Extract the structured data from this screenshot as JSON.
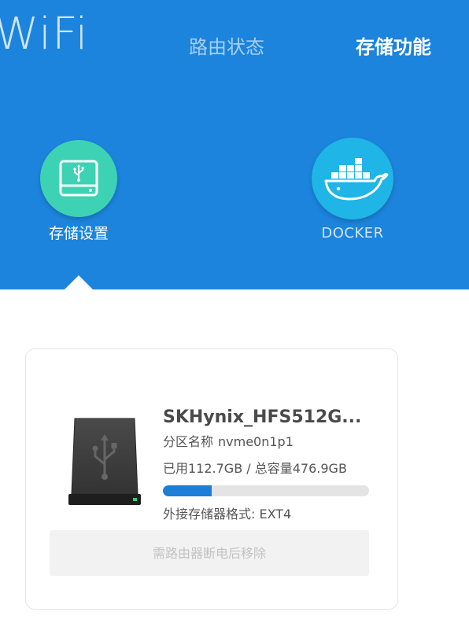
{
  "header": {
    "logo_text": "WiFi",
    "nav": [
      {
        "label": "路由状态",
        "active": false
      },
      {
        "label": "存储功能",
        "active": true
      }
    ],
    "background_color": "#1c84dc"
  },
  "features": [
    {
      "label": "存储设置",
      "icon": "usb-drive-icon",
      "color": "#3ed2b4",
      "selected": true
    },
    {
      "label": "DOCKER",
      "icon": "docker-whale-icon",
      "color": "#1fb5e6",
      "selected": false
    }
  ],
  "disk": {
    "icon": "usb-hard-drive-icon",
    "name": "SKHynix_HFS512G...",
    "partition_label": "分区名称",
    "partition_value": "nvme0n1p1",
    "usage_text": "已用112.7GB / 总容量476.9GB",
    "used_gb": 112.7,
    "total_gb": 476.9,
    "usage_fraction": 0.236,
    "format_text": "外接存储器格式: EXT4",
    "eject_label": "需路由器断电后移除",
    "bar_color": "#1c7ed6"
  }
}
